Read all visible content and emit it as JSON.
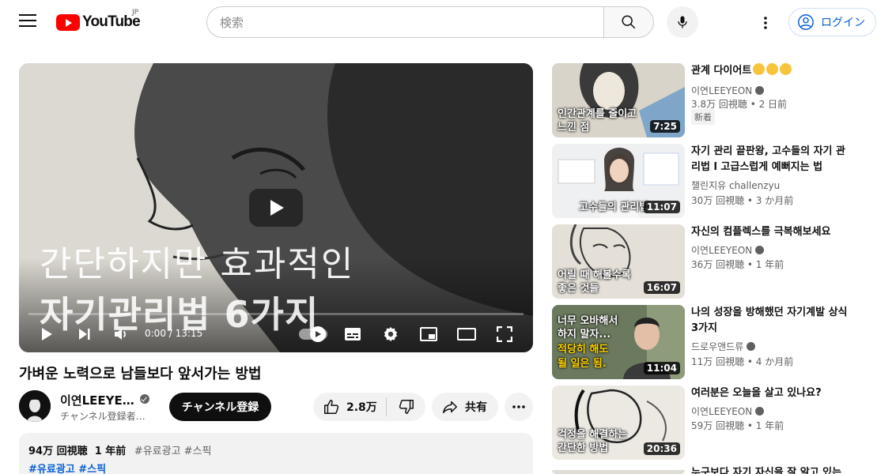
{
  "header": {
    "logo_text": "YouTube",
    "logo_region": "JP",
    "search_placeholder": "検索",
    "login_label": "ログイン"
  },
  "player": {
    "overlay_line1": "간단하지만 효과적인",
    "overlay_line2": "자기관리법 6가지",
    "time": "0:00 / 13:15",
    "progress": 0
  },
  "video": {
    "title": "가벼운 노력으로 남들보다 앞서가는 방법",
    "channel": "이연LEEYE…",
    "subscribers": "チャンネル登録者…",
    "subscribe_label": "チャンネル登録",
    "likes": "2.8万",
    "share_label": "共有",
    "views": "94万 回視聴",
    "age": "1 年前",
    "tags_inline": "#유료광고 #스픽",
    "tags_link": "#유료광고 #스픽"
  },
  "recommendations": [
    {
      "title": "관계 다이어트",
      "emoji_count": 3,
      "channel": "이연LEEYEON",
      "meta": "3.8万 回視聴 • 2 日前",
      "badge": "新着",
      "duration": "7:25",
      "thumb_lines": [
        "인간관계를 줄이고",
        "느낀 점"
      ]
    },
    {
      "title": "자기 관리 끝판왕, 고수들의 자기 관리법 l 고급스럽게 예뻐지는 법 (얼...",
      "channel": "챌린지유 challenzyu",
      "meta": "30万 回視聴 • 3 か月前",
      "duration": "11:07",
      "thumb_lines": [
        "고수들의 관리법"
      ]
    },
    {
      "title": "자신의 컴플렉스를 극복해보세요",
      "channel": "이연LEEYEON",
      "meta": "36万 回視聴 • 1 年前",
      "duration": "16:07",
      "thumb_lines": [
        "어릴 때 해볼수록",
        "좋은 것들"
      ]
    },
    {
      "title": "나의 성장을 방해했던 자기계발 상식 3가지",
      "channel": "드로우앤드류",
      "meta": "11万 回視聴 • 4 か月前",
      "duration": "11:04",
      "thumb_lines": [
        "너무 오바해서",
        "하지 말자...",
        "적당히 해도",
        "될 일은 됨."
      ]
    },
    {
      "title": "여러분은 오늘을 살고 있나요?",
      "channel": "이연LEEYEON",
      "meta": "59万 回視聴 • 1 年前",
      "duration": "20:36",
      "thumb_lines": [
        "걱정을 해결하는",
        "간단한 방법"
      ]
    },
    {
      "title": "누구보다 자기 자신을 잘 알고 있는",
      "channel": "",
      "meta": "",
      "duration": "",
      "thumb_lines": []
    }
  ]
}
